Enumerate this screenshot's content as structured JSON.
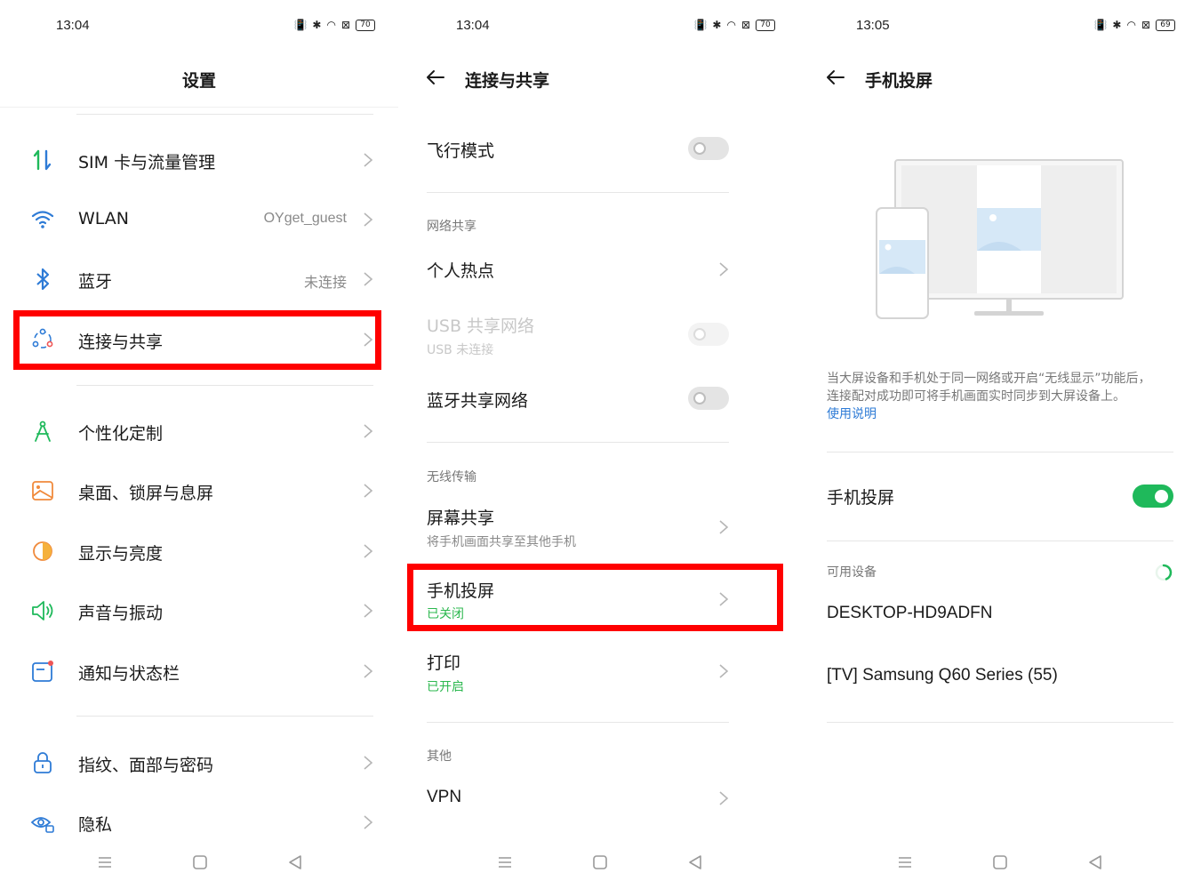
{
  "colors": {
    "accent_green": "#1fb95b",
    "link_blue": "#2e7bd6",
    "highlight_red": "#ff0000",
    "secondary_text": "#8a8a8a"
  },
  "screen1": {
    "status": {
      "time": "13:04",
      "battery": "70"
    },
    "title": "设置",
    "items": [
      {
        "icon": "data-arrows-icon",
        "label": "SIM 卡与流量管理",
        "value": ""
      },
      {
        "icon": "wifi-icon",
        "label": "WLAN",
        "value": "OYget_guest"
      },
      {
        "icon": "bluetooth-icon",
        "label": "蓝牙",
        "value": "未连接"
      },
      {
        "icon": "share-nodes-icon",
        "label": "连接与共享",
        "value": ""
      },
      {
        "icon": "compass-icon",
        "label": "个性化定制",
        "value": ""
      },
      {
        "icon": "wallpaper-icon",
        "label": "桌面、锁屏与息屏",
        "value": ""
      },
      {
        "icon": "brightness-icon",
        "label": "显示与亮度",
        "value": ""
      },
      {
        "icon": "speaker-icon",
        "label": "声音与振动",
        "value": ""
      },
      {
        "icon": "notification-icon",
        "label": "通知与状态栏",
        "value": ""
      },
      {
        "icon": "lock-icon",
        "label": "指纹、面部与密码",
        "value": ""
      },
      {
        "icon": "privacy-eye-icon",
        "label": "隐私",
        "value": ""
      }
    ]
  },
  "screen2": {
    "status": {
      "time": "13:04",
      "battery": "70"
    },
    "title": "连接与共享",
    "airplane": {
      "label": "飞行模式",
      "on": false
    },
    "section_network": "网络共享",
    "hotspot": {
      "label": "个人热点"
    },
    "usb": {
      "label": "USB 共享网络",
      "sub": "USB 未连接",
      "on": false,
      "enabled": false
    },
    "bt_share": {
      "label": "蓝牙共享网络",
      "on": false
    },
    "section_wireless": "无线传输",
    "screen_share": {
      "label": "屏幕共享",
      "sub": "将手机画面共享至其他手机"
    },
    "cast": {
      "label": "手机投屏",
      "sub": "已关闭"
    },
    "print": {
      "label": "打印",
      "sub": "已开启"
    },
    "section_other": "其他",
    "vpn": {
      "label": "VPN"
    }
  },
  "screen3": {
    "status": {
      "time": "13:05",
      "battery": "69"
    },
    "title": "手机投屏",
    "desc_line1": "当大屏设备和手机处于同一网络或开启“无线显示”功能后，",
    "desc_line2": "连接配对成功即可将手机画面实时同步到大屏设备上。",
    "help_link": "使用说明",
    "cast_toggle": {
      "label": "手机投屏",
      "on": true
    },
    "section_devices": "可用设备",
    "devices": [
      "DESKTOP-HD9ADFN",
      "[TV] Samsung Q60 Series (55)"
    ]
  }
}
